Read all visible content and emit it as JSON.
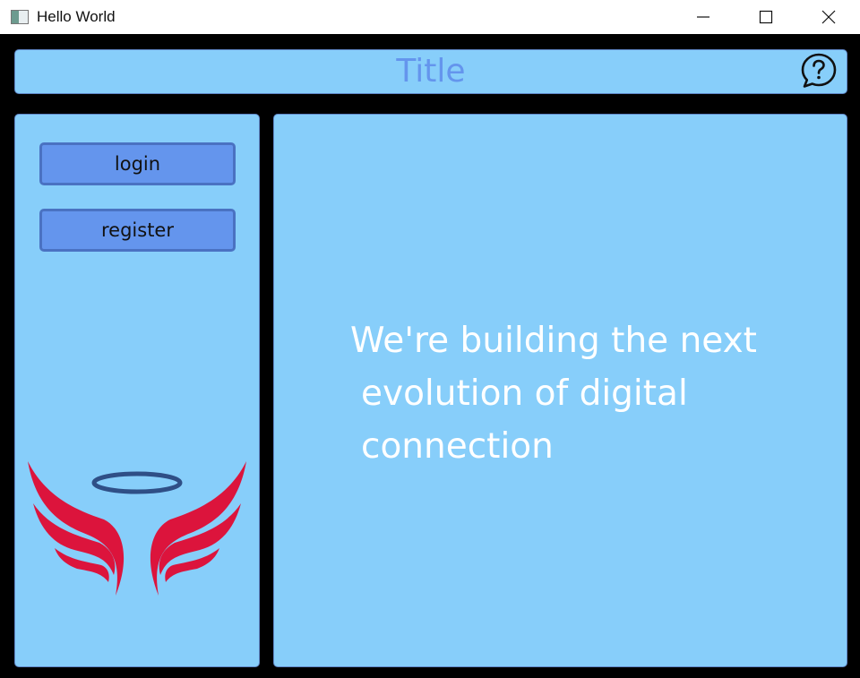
{
  "window": {
    "title": "Hello World"
  },
  "header": {
    "title": "Title",
    "help_icon": "help-chat-icon"
  },
  "sidebar": {
    "buttons": [
      {
        "label": "login"
      },
      {
        "label": "register"
      }
    ],
    "logo": "winged-halo-logo"
  },
  "main": {
    "tagline_lines": [
      "We're building the next",
      "evolution of digital",
      "connection"
    ]
  },
  "colors": {
    "panel_bg": "#87cefa",
    "button_bg": "#6495ed",
    "title_color": "#6495ed",
    "window_bg": "#000000",
    "logo_wings": "#dc143c",
    "logo_halo": "#2f4f86"
  }
}
